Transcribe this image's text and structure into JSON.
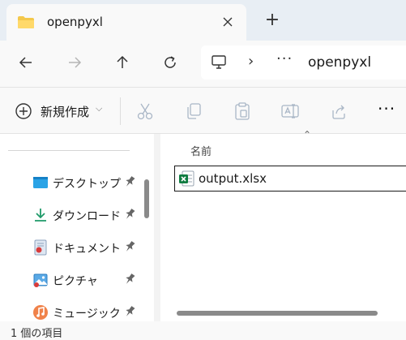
{
  "window": {
    "tab_title": "openpyxl",
    "tab_icon": "folder-icon",
    "new_tab_label": "+"
  },
  "address": {
    "chevron": "›",
    "more": "···",
    "crumb": "openpyxl"
  },
  "commands": {
    "new_label": "新規作成",
    "new_dropdown": "⌵",
    "more": "···",
    "icons": [
      "cut-icon",
      "copy-icon",
      "paste-icon",
      "rename-icon",
      "share-icon"
    ]
  },
  "nav": {
    "items": [
      {
        "label": "デスクトップ",
        "icon": "desktop-icon",
        "pinned": true
      },
      {
        "label": "ダウンロード",
        "icon": "download-icon",
        "pinned": true
      },
      {
        "label": "ドキュメント",
        "icon": "documents-icon",
        "pinned": true
      },
      {
        "label": "ピクチャ",
        "icon": "pictures-icon",
        "pinned": true
      },
      {
        "label": "ミュージック",
        "icon": "music-icon",
        "pinned": true
      }
    ]
  },
  "content": {
    "column_name": "名前",
    "sort_indicator": "⌃",
    "files": [
      {
        "name": "output.xlsx",
        "icon": "excel-file-icon",
        "selected": true
      }
    ]
  },
  "status": {
    "text": "1 個の項目"
  },
  "colors": {
    "accent": "#005fb8",
    "excel_green": "#107c41",
    "folder_yellow": "#f4c84b"
  }
}
